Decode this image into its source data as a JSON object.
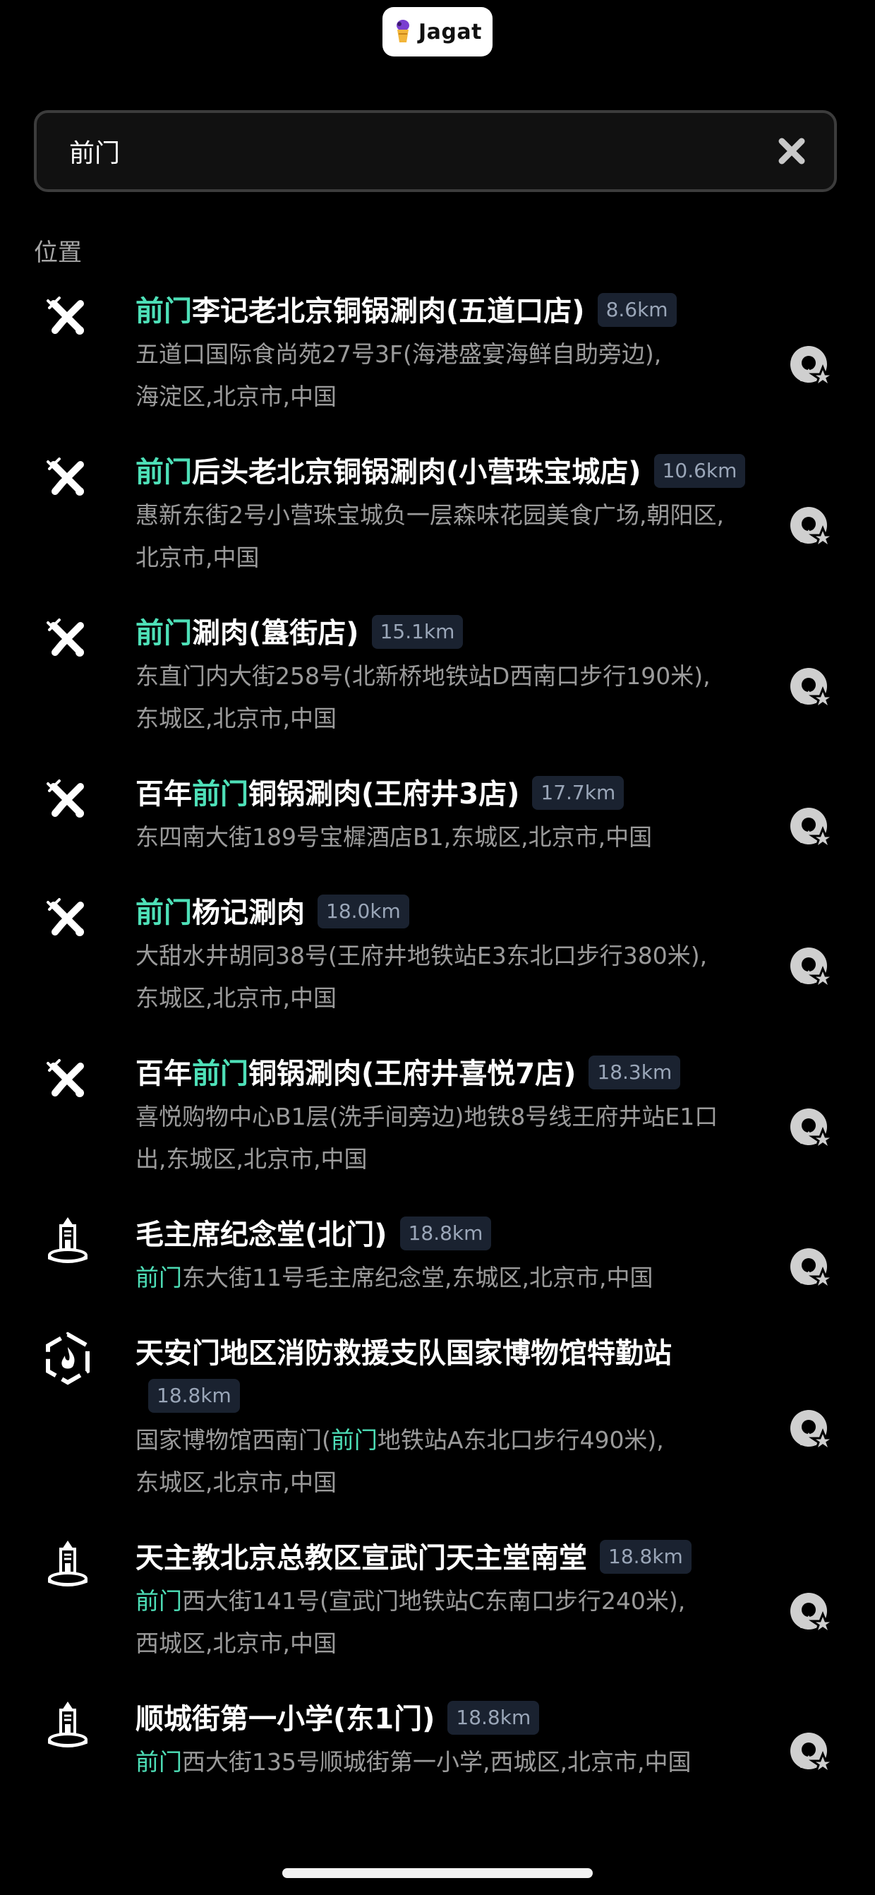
{
  "app": {
    "name": "Jagat"
  },
  "search": {
    "query": "前门"
  },
  "section": {
    "label": "位置"
  },
  "colors": {
    "highlight": "#4ee0b8",
    "badge_bg": "#1a2230",
    "badge_text": "#9aa6b8",
    "address_text": "#9b9b9b"
  },
  "results": [
    {
      "category_icon": "food-icon",
      "title_pre": "",
      "title_hl": "前门",
      "title_post": "李记老北京铜锅涮肉(五道口店)",
      "distance": "8.6km",
      "addr_pre": "",
      "addr_hl": "",
      "addr_post": "五道口国际食尚苑27号3F(海港盛宴海鲜自助旁边),",
      "addr2": "海淀区,北京市,中国"
    },
    {
      "category_icon": "food-icon",
      "title_pre": "",
      "title_hl": "前门",
      "title_post": "后头老北京铜锅涮肉(小营珠宝城店)",
      "distance": "10.6km",
      "addr_pre": "",
      "addr_hl": "",
      "addr_post": "惠新东街2号小营珠宝城负一层森味花园美食广场,朝阳区,",
      "addr2": "北京市,中国"
    },
    {
      "category_icon": "food-icon",
      "title_pre": "",
      "title_hl": "前门",
      "title_post": "涮肉(簋街店)",
      "distance": "15.1km",
      "addr_pre": "",
      "addr_hl": "",
      "addr_post": "东直门内大街258号(北新桥地铁站D西南口步行190米),",
      "addr2": "东城区,北京市,中国"
    },
    {
      "category_icon": "food-icon",
      "title_pre": "百年",
      "title_hl": "前门",
      "title_post": "铜锅涮肉(王府井3店)",
      "distance": "17.7km",
      "addr_pre": "",
      "addr_hl": "",
      "addr_post": "东四南大街189号宝樨酒店B1,东城区,北京市,中国",
      "addr2": ""
    },
    {
      "category_icon": "food-icon",
      "title_pre": "",
      "title_hl": "前门",
      "title_post": "杨记涮肉",
      "distance": "18.0km",
      "addr_pre": "",
      "addr_hl": "",
      "addr_post": "大甜水井胡同38号(王府井地铁站E3东北口步行380米),",
      "addr2": "东城区,北京市,中国"
    },
    {
      "category_icon": "food-icon",
      "title_pre": "百年",
      "title_hl": "前门",
      "title_post": "铜锅涮肉(王府井喜悦7店)",
      "distance": "18.3km",
      "addr_pre": "",
      "addr_hl": "",
      "addr_post": "喜悦购物中心B1层(洗手间旁边)地铁8号线王府井站E1口",
      "addr2": "出,东城区,北京市,中国"
    },
    {
      "category_icon": "landmark-icon",
      "title_pre": "毛主席纪念堂(北门)",
      "title_hl": "",
      "title_post": "",
      "distance": "18.8km",
      "addr_pre": "",
      "addr_hl": "前门",
      "addr_post": "东大街11号毛主席纪念堂,东城区,北京市,中国",
      "addr2": ""
    },
    {
      "category_icon": "fire-station-icon",
      "title_pre": "天安门地区消防救援支队国家博物馆特勤站",
      "title_hl": "",
      "title_post": "",
      "distance": "18.8km",
      "addr_pre": "国家博物馆西南门(",
      "addr_hl": "前门",
      "addr_post": "地铁站A东北口步行490米),",
      "addr2": "东城区,北京市,中国"
    },
    {
      "category_icon": "landmark-icon",
      "title_pre": "天主教北京总教区宣武门天主堂南堂",
      "title_hl": "",
      "title_post": "",
      "distance": "18.8km",
      "addr_pre": "",
      "addr_hl": "前门",
      "addr_post": "西大街141号(宣武门地铁站C东南口步行240米),",
      "addr2": "西城区,北京市,中国"
    },
    {
      "category_icon": "landmark-icon",
      "title_pre": "顺城街第一小学(东1门)",
      "title_hl": "",
      "title_post": "",
      "distance": "18.8km",
      "addr_pre": "",
      "addr_hl": "前门",
      "addr_post": "西大街135号顺城街第一小学,西城区,北京市,中国",
      "addr2": ""
    }
  ]
}
